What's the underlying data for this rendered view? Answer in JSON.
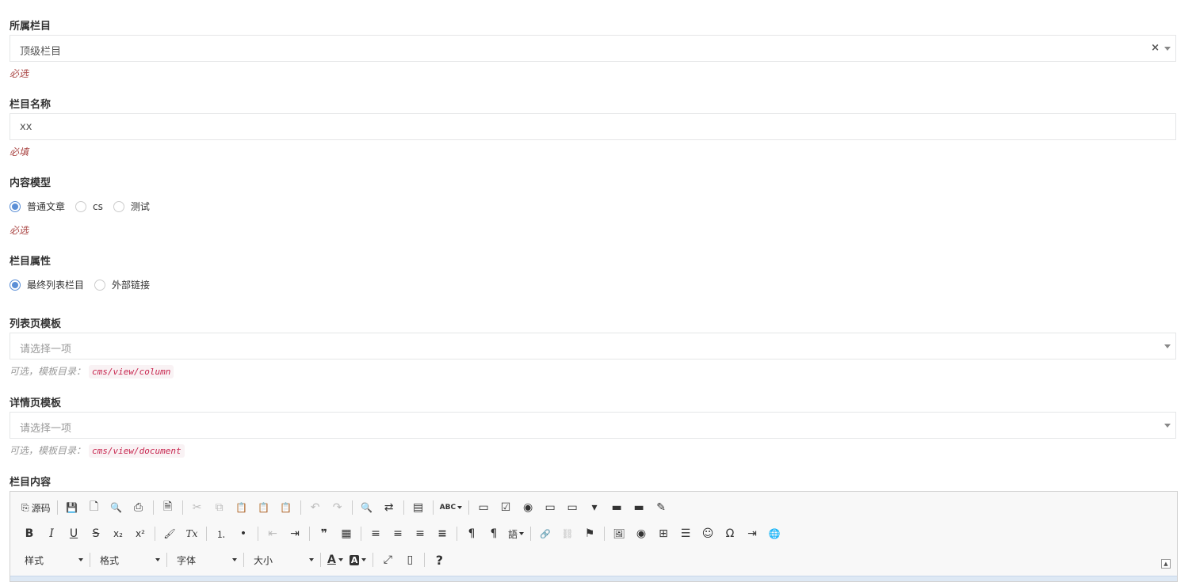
{
  "fields": {
    "parent": {
      "label": "所属栏目",
      "value": "顶级栏目",
      "clear": "×",
      "hint": "必选"
    },
    "name": {
      "label": "栏目名称",
      "value": "xx",
      "hint": "必填"
    },
    "model": {
      "label": "内容模型",
      "options": [
        {
          "label": "普通文章",
          "checked": true
        },
        {
          "label": "cs",
          "checked": false
        },
        {
          "label": "测试",
          "checked": false
        }
      ],
      "hint": "必选"
    },
    "attr": {
      "label": "栏目属性",
      "options": [
        {
          "label": "最终列表栏目",
          "checked": true
        },
        {
          "label": "外部链接",
          "checked": false
        }
      ]
    },
    "list_tpl": {
      "label": "列表页模板",
      "placeholder": "请选择一项",
      "hint": "可选，模板目录：",
      "path": "cms/view/column"
    },
    "detail_tpl": {
      "label": "详情页模板",
      "placeholder": "请选择一项",
      "hint": "可选，模板目录：",
      "path": "cms/view/document"
    },
    "content": {
      "label": "栏目内容"
    }
  },
  "editor": {
    "source_label": "源码",
    "combos": {
      "style": "样式",
      "format": "格式",
      "font": "字体",
      "size": "大小"
    },
    "glyphs": {
      "source": "⎘",
      "save": "💾",
      "newpage": "🗋",
      "preview": "🔍",
      "print": "⎙",
      "templates": "🗎",
      "cut": "✂",
      "copy": "⧉",
      "paste": "📋",
      "paste_text": "📋",
      "paste_word": "📋",
      "undo": "↶",
      "redo": "↷",
      "find": "🔍",
      "replace": "⇄",
      "selectall": "▤",
      "spell": "ABC",
      "form": "▭",
      "checkbox": "☑",
      "radio": "◉",
      "textfield": "▭",
      "textarea": "▭",
      "select": "▾",
      "button": "▬",
      "imagebutton": "▬",
      "hidden": "✎",
      "bold": "B",
      "italic": "I",
      "underline": "U",
      "strike": "S",
      "sub": "x₂",
      "sup": "x²",
      "copyformat": "🖌",
      "removeformat": "Tx",
      "ol": "⒈",
      "ul": "•",
      "outdent": "⇤",
      "indent": "⇥",
      "quote": "❞",
      "div": "▦",
      "left": "≡",
      "center": "≡",
      "right": "≡",
      "justify": "≡",
      "ltr": "¶",
      "rtl": "¶",
      "lang": "語",
      "link": "🔗",
      "unlink": "⛓",
      "anchor": "⚑",
      "image": "🖼",
      "flash": "◉",
      "table": "⊞",
      "hr": "☰",
      "smiley": "☺",
      "specialchar": "Ω",
      "pagebreak": "⇥",
      "iframe": "🌐",
      "textcolor": "A",
      "bgcolor": "A",
      "maximize": "⤢",
      "blocks": "▯",
      "help": "?"
    },
    "colors": {
      "radio": "#5b8fd6",
      "hint_required": "#a94442",
      "code_text": "#c7254e"
    }
  }
}
